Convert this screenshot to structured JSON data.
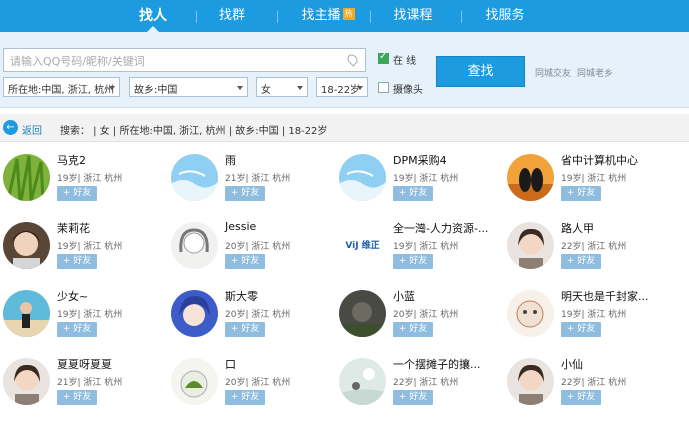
{
  "colors": {
    "accent": "#1d9be0",
    "panel": "#e6f1fa",
    "add_button": "#8fbddf",
    "online_check": "#3aa857"
  },
  "tabs": [
    {
      "label": "找人",
      "active": true
    },
    {
      "label": "找群",
      "active": false
    },
    {
      "label": "找主播",
      "active": false,
      "badge": "热"
    },
    {
      "label": "找课程",
      "active": false
    },
    {
      "label": "找服务",
      "active": false
    }
  ],
  "search": {
    "placeholder": "请输入QQ号码/昵称/关键词",
    "online_label": "在 线",
    "online_checked": true,
    "webcam_label": "摄像头",
    "webcam_checked": false,
    "location": "所在地:中国, 浙江, 杭州",
    "hometown": "故乡:中国",
    "gender": "女",
    "age": "18-22岁",
    "find_button": "查找",
    "link_same_city": "同城交友",
    "link_fellow": "同城老乡"
  },
  "filterbar": {
    "back_label": "返回",
    "summary": "搜索：  |  女  |  所在地:中国, 浙江, 杭州  |  故乡:中国  |  18-22岁"
  },
  "results": [
    {
      "name": "马克2",
      "info": "19岁| 浙江 杭州",
      "avatar": "grass"
    },
    {
      "name": "雨",
      "info": "21岁| 浙江 杭州",
      "avatar": "sky"
    },
    {
      "name": "DPM采购4",
      "info": "19岁| 浙江 杭州",
      "avatar": "sky"
    },
    {
      "name": "省中计算机中心",
      "info": "19岁| 浙江 杭州",
      "avatar": "penguins"
    },
    {
      "name": "茉莉花",
      "info": "19岁| 浙江 杭州",
      "avatar": "portrait-dark"
    },
    {
      "name": "Jessie",
      "info": "20岁| 浙江 杭州",
      "avatar": "sketch"
    },
    {
      "name": "全一灣-人力资源-...",
      "info": "19岁| 浙江 杭州",
      "avatar": "logo",
      "logo_text": "ViJ 维正"
    },
    {
      "name": "路人甲",
      "info": "22岁| 浙江 杭州",
      "avatar": "portrait-light"
    },
    {
      "name": "少女~",
      "info": "19岁| 浙江 杭州",
      "avatar": "beach"
    },
    {
      "name": "斯大零",
      "info": "20岁| 浙江 杭州",
      "avatar": "anime"
    },
    {
      "name": "小蓝",
      "info": "20岁| 浙江 杭州",
      "avatar": "dark"
    },
    {
      "name": "明天也是千封家...",
      "info": "19岁| 浙江 杭州",
      "avatar": "cartoon"
    },
    {
      "name": "夏夏呀夏夏",
      "info": "21岁| 浙江 杭州",
      "avatar": "portrait-light"
    },
    {
      "name": "口",
      "info": "20岁| 浙江 杭州",
      "avatar": "terrarium"
    },
    {
      "name": "一个摆摊子的攘...",
      "info": "22岁| 浙江 杭州",
      "avatar": "illustration"
    },
    {
      "name": "小仙",
      "info": "22岁| 浙江 杭州",
      "avatar": "portrait-light"
    }
  ],
  "add_friend_label": "+ 好友"
}
